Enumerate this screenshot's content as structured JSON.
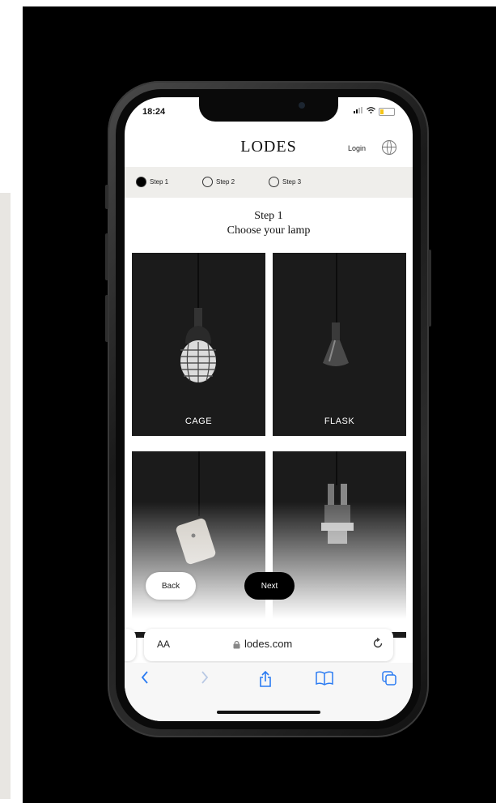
{
  "status_bar": {
    "time": "18:24"
  },
  "header": {
    "logo": "LODES",
    "login": "Login"
  },
  "steps": [
    {
      "label": "Step 1",
      "active": true
    },
    {
      "label": "Step 2",
      "active": false
    },
    {
      "label": "Step 3",
      "active": false
    }
  ],
  "page": {
    "step_title": "Step 1",
    "subtitle": "Choose your lamp"
  },
  "lamps": [
    {
      "name": "CAGE"
    },
    {
      "name": "FLASK"
    },
    {
      "name": ""
    },
    {
      "name": ""
    }
  ],
  "nav_buttons": {
    "back": "Back",
    "next": "Next"
  },
  "browser": {
    "text_size": "AA",
    "url": "lodes.com"
  },
  "colors": {
    "accent": "#2a7bf2",
    "card_bg": "#1b1b1b",
    "steps_bg": "#efeeeb",
    "backdrop": "#000000"
  }
}
